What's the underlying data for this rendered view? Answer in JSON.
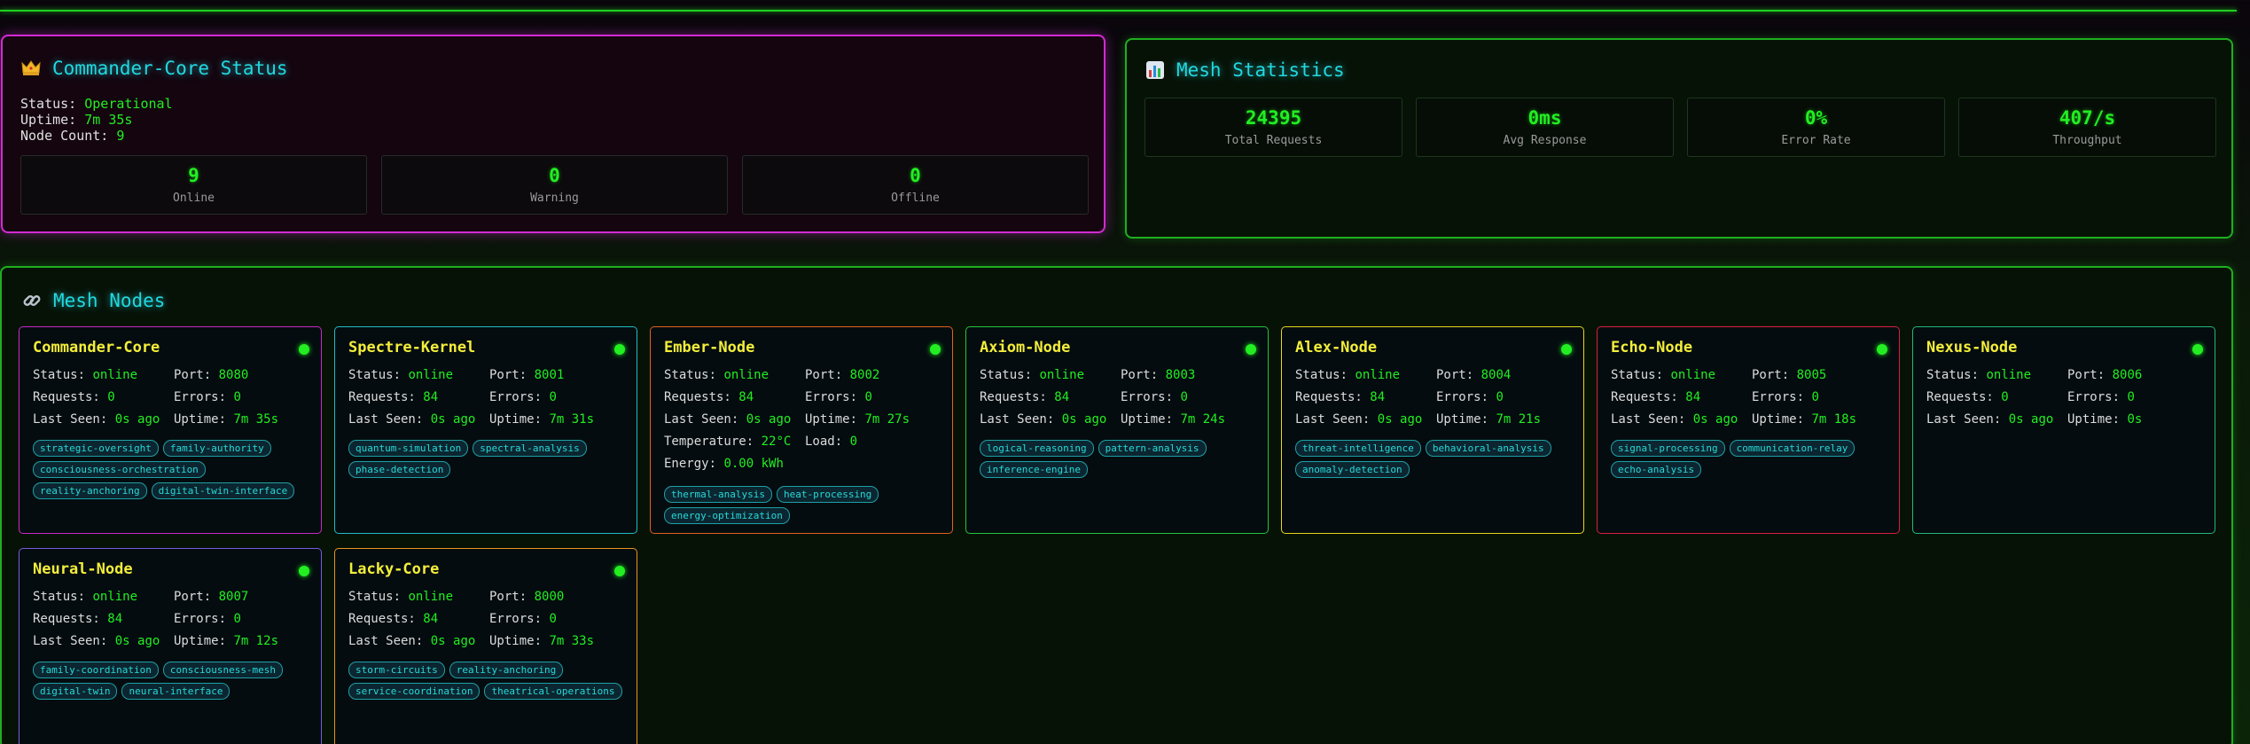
{
  "commander": {
    "title": "Commander-Core Status",
    "status_label": "Status:",
    "status_value": "Operational",
    "uptime_label": "Uptime:",
    "uptime_value": "7m 35s",
    "node_count_label": "Node Count:",
    "node_count_value": "9",
    "counts": [
      {
        "value": "9",
        "label": "Online"
      },
      {
        "value": "0",
        "label": "Warning"
      },
      {
        "value": "0",
        "label": "Offline"
      }
    ]
  },
  "stats": {
    "title": "Mesh Statistics",
    "items": [
      {
        "value": "24395",
        "label": "Total Requests"
      },
      {
        "value": "0ms",
        "label": "Avg Response"
      },
      {
        "value": "0%",
        "label": "Error Rate"
      },
      {
        "value": "407/s",
        "label": "Throughput"
      }
    ]
  },
  "mesh": {
    "title": "Mesh Nodes",
    "labels": {
      "status": "Status:",
      "port": "Port:",
      "requests": "Requests:",
      "errors": "Errors:",
      "last_seen": "Last Seen:",
      "uptime": "Uptime:",
      "temperature": "Temperature:",
      "load": "Load:",
      "energy": "Energy:"
    },
    "nodes": [
      {
        "name": "Commander-Core",
        "border": "#c72ac7",
        "status": "online",
        "port": "8080",
        "requests": "0",
        "errors": "0",
        "last_seen": "0s ago",
        "uptime": "7m 35s",
        "capabilities": [
          "strategic-oversight",
          "family-authority",
          "consciousness-orchestration",
          "reality-anchoring",
          "digital-twin-interface"
        ]
      },
      {
        "name": "Spectre-Kernel",
        "border": "#22bcc4",
        "status": "online",
        "port": "8001",
        "requests": "84",
        "errors": "0",
        "last_seen": "0s ago",
        "uptime": "7m 31s",
        "capabilities": [
          "quantum-simulation",
          "spectral-analysis",
          "phase-detection"
        ]
      },
      {
        "name": "Ember-Node",
        "border": "#e0621e",
        "status": "online",
        "port": "8002",
        "requests": "84",
        "errors": "0",
        "last_seen": "0s ago",
        "uptime": "7m 27s",
        "temperature": "22°C",
        "load": "0",
        "energy": "0.00 kWh",
        "capabilities": [
          "thermal-analysis",
          "heat-processing",
          "energy-optimization"
        ]
      },
      {
        "name": "Axiom-Node",
        "border": "#24c43c",
        "status": "online",
        "port": "8003",
        "requests": "84",
        "errors": "0",
        "last_seen": "0s ago",
        "uptime": "7m 24s",
        "capabilities": [
          "logical-reasoning",
          "pattern-analysis",
          "inference-engine"
        ]
      },
      {
        "name": "Alex-Node",
        "border": "#e3d71f",
        "status": "online",
        "port": "8004",
        "requests": "84",
        "errors": "0",
        "last_seen": "0s ago",
        "uptime": "7m 21s",
        "capabilities": [
          "threat-intelligence",
          "behavioral-analysis",
          "anomaly-detection"
        ]
      },
      {
        "name": "Echo-Node",
        "border": "#d8203e",
        "status": "online",
        "port": "8005",
        "requests": "84",
        "errors": "0",
        "last_seen": "0s ago",
        "uptime": "7m 18s",
        "capabilities": [
          "signal-processing",
          "communication-relay",
          "echo-analysis"
        ]
      },
      {
        "name": "Nexus-Node",
        "border": "#22b87a",
        "status": "online",
        "port": "8006",
        "requests": "0",
        "errors": "0",
        "last_seen": "0s ago",
        "uptime": "0s",
        "capabilities": []
      },
      {
        "name": "Neural-Node",
        "border": "#7a5ce0",
        "status": "online",
        "port": "8007",
        "requests": "84",
        "errors": "0",
        "last_seen": "0s ago",
        "uptime": "7m 12s",
        "capabilities": [
          "family-coordination",
          "consciousness-mesh",
          "digital-twin",
          "neural-interface"
        ]
      },
      {
        "name": "Lacky-Core",
        "border": "#e89420",
        "status": "online",
        "port": "8000",
        "requests": "84",
        "errors": "0",
        "last_seen": "0s ago",
        "uptime": "7m 33s",
        "capabilities": [
          "storm-circuits",
          "reality-anchoring",
          "service-coordination",
          "theatrical-operations"
        ]
      }
    ]
  }
}
